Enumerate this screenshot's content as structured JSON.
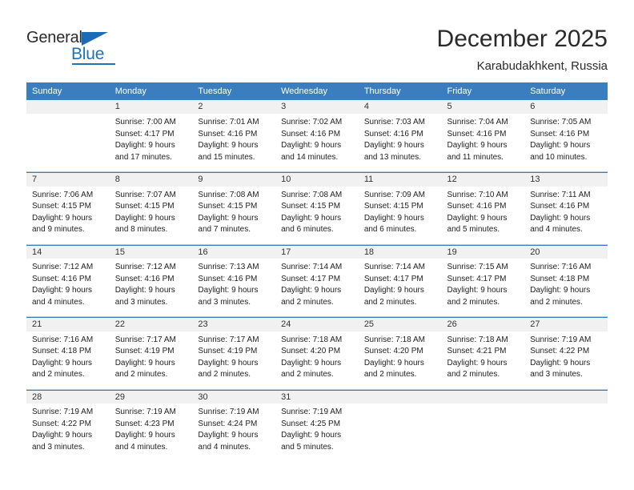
{
  "logo": {
    "general": "General",
    "blue": "Blue",
    "triangle_color": "#1c6cb5",
    "blue_color": "#1c72bc"
  },
  "header": {
    "title": "December 2025",
    "subtitle": "Karabudakhkent, Russia"
  },
  "calendar": {
    "header_bg": "#3a7ebf",
    "daynum_bg": "#f1f1f1",
    "weekday_headers": [
      "Sunday",
      "Monday",
      "Tuesday",
      "Wednesday",
      "Thursday",
      "Friday",
      "Saturday"
    ],
    "weeks": [
      [
        {
          "day": "",
          "lines": []
        },
        {
          "day": "1",
          "lines": [
            "Sunrise: 7:00 AM",
            "Sunset: 4:17 PM",
            "Daylight: 9 hours",
            "and 17 minutes."
          ]
        },
        {
          "day": "2",
          "lines": [
            "Sunrise: 7:01 AM",
            "Sunset: 4:16 PM",
            "Daylight: 9 hours",
            "and 15 minutes."
          ]
        },
        {
          "day": "3",
          "lines": [
            "Sunrise: 7:02 AM",
            "Sunset: 4:16 PM",
            "Daylight: 9 hours",
            "and 14 minutes."
          ]
        },
        {
          "day": "4",
          "lines": [
            "Sunrise: 7:03 AM",
            "Sunset: 4:16 PM",
            "Daylight: 9 hours",
            "and 13 minutes."
          ]
        },
        {
          "day": "5",
          "lines": [
            "Sunrise: 7:04 AM",
            "Sunset: 4:16 PM",
            "Daylight: 9 hours",
            "and 11 minutes."
          ]
        },
        {
          "day": "6",
          "lines": [
            "Sunrise: 7:05 AM",
            "Sunset: 4:16 PM",
            "Daylight: 9 hours",
            "and 10 minutes."
          ]
        }
      ],
      [
        {
          "day": "7",
          "lines": [
            "Sunrise: 7:06 AM",
            "Sunset: 4:15 PM",
            "Daylight: 9 hours",
            "and 9 minutes."
          ]
        },
        {
          "day": "8",
          "lines": [
            "Sunrise: 7:07 AM",
            "Sunset: 4:15 PM",
            "Daylight: 9 hours",
            "and 8 minutes."
          ]
        },
        {
          "day": "9",
          "lines": [
            "Sunrise: 7:08 AM",
            "Sunset: 4:15 PM",
            "Daylight: 9 hours",
            "and 7 minutes."
          ]
        },
        {
          "day": "10",
          "lines": [
            "Sunrise: 7:08 AM",
            "Sunset: 4:15 PM",
            "Daylight: 9 hours",
            "and 6 minutes."
          ]
        },
        {
          "day": "11",
          "lines": [
            "Sunrise: 7:09 AM",
            "Sunset: 4:15 PM",
            "Daylight: 9 hours",
            "and 6 minutes."
          ]
        },
        {
          "day": "12",
          "lines": [
            "Sunrise: 7:10 AM",
            "Sunset: 4:16 PM",
            "Daylight: 9 hours",
            "and 5 minutes."
          ]
        },
        {
          "day": "13",
          "lines": [
            "Sunrise: 7:11 AM",
            "Sunset: 4:16 PM",
            "Daylight: 9 hours",
            "and 4 minutes."
          ]
        }
      ],
      [
        {
          "day": "14",
          "lines": [
            "Sunrise: 7:12 AM",
            "Sunset: 4:16 PM",
            "Daylight: 9 hours",
            "and 4 minutes."
          ]
        },
        {
          "day": "15",
          "lines": [
            "Sunrise: 7:12 AM",
            "Sunset: 4:16 PM",
            "Daylight: 9 hours",
            "and 3 minutes."
          ]
        },
        {
          "day": "16",
          "lines": [
            "Sunrise: 7:13 AM",
            "Sunset: 4:16 PM",
            "Daylight: 9 hours",
            "and 3 minutes."
          ]
        },
        {
          "day": "17",
          "lines": [
            "Sunrise: 7:14 AM",
            "Sunset: 4:17 PM",
            "Daylight: 9 hours",
            "and 2 minutes."
          ]
        },
        {
          "day": "18",
          "lines": [
            "Sunrise: 7:14 AM",
            "Sunset: 4:17 PM",
            "Daylight: 9 hours",
            "and 2 minutes."
          ]
        },
        {
          "day": "19",
          "lines": [
            "Sunrise: 7:15 AM",
            "Sunset: 4:17 PM",
            "Daylight: 9 hours",
            "and 2 minutes."
          ]
        },
        {
          "day": "20",
          "lines": [
            "Sunrise: 7:16 AM",
            "Sunset: 4:18 PM",
            "Daylight: 9 hours",
            "and 2 minutes."
          ]
        }
      ],
      [
        {
          "day": "21",
          "lines": [
            "Sunrise: 7:16 AM",
            "Sunset: 4:18 PM",
            "Daylight: 9 hours",
            "and 2 minutes."
          ]
        },
        {
          "day": "22",
          "lines": [
            "Sunrise: 7:17 AM",
            "Sunset: 4:19 PM",
            "Daylight: 9 hours",
            "and 2 minutes."
          ]
        },
        {
          "day": "23",
          "lines": [
            "Sunrise: 7:17 AM",
            "Sunset: 4:19 PM",
            "Daylight: 9 hours",
            "and 2 minutes."
          ]
        },
        {
          "day": "24",
          "lines": [
            "Sunrise: 7:18 AM",
            "Sunset: 4:20 PM",
            "Daylight: 9 hours",
            "and 2 minutes."
          ]
        },
        {
          "day": "25",
          "lines": [
            "Sunrise: 7:18 AM",
            "Sunset: 4:20 PM",
            "Daylight: 9 hours",
            "and 2 minutes."
          ]
        },
        {
          "day": "26",
          "lines": [
            "Sunrise: 7:18 AM",
            "Sunset: 4:21 PM",
            "Daylight: 9 hours",
            "and 2 minutes."
          ]
        },
        {
          "day": "27",
          "lines": [
            "Sunrise: 7:19 AM",
            "Sunset: 4:22 PM",
            "Daylight: 9 hours",
            "and 3 minutes."
          ]
        }
      ],
      [
        {
          "day": "28",
          "lines": [
            "Sunrise: 7:19 AM",
            "Sunset: 4:22 PM",
            "Daylight: 9 hours",
            "and 3 minutes."
          ]
        },
        {
          "day": "29",
          "lines": [
            "Sunrise: 7:19 AM",
            "Sunset: 4:23 PM",
            "Daylight: 9 hours",
            "and 4 minutes."
          ]
        },
        {
          "day": "30",
          "lines": [
            "Sunrise: 7:19 AM",
            "Sunset: 4:24 PM",
            "Daylight: 9 hours",
            "and 4 minutes."
          ]
        },
        {
          "day": "31",
          "lines": [
            "Sunrise: 7:19 AM",
            "Sunset: 4:25 PM",
            "Daylight: 9 hours",
            "and 5 minutes."
          ]
        },
        {
          "day": "",
          "lines": []
        },
        {
          "day": "",
          "lines": []
        },
        {
          "day": "",
          "lines": []
        }
      ]
    ]
  }
}
